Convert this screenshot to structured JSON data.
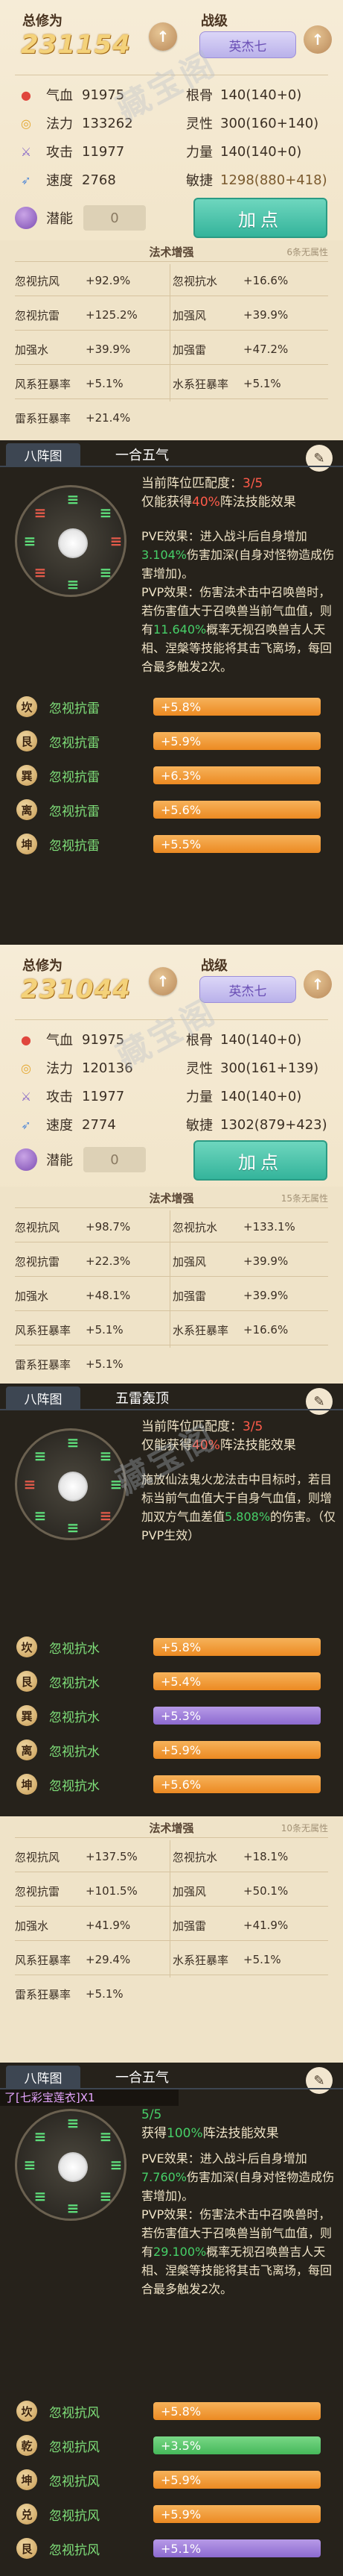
{
  "labels": {
    "total": "总修为",
    "zhanji": "战级",
    "potential": "潜能",
    "add_point": "加点",
    "fa_title": "法术增强",
    "formation_tab": "八阵图"
  },
  "stats_1": {
    "total_value": "231154",
    "zhanji_value": "英杰七",
    "qixue": {
      "k": "气血",
      "v": "91975"
    },
    "genggu": {
      "k": "根骨",
      "v": "140(140+0)"
    },
    "fali": {
      "k": "法力",
      "v": "133262"
    },
    "lingxing": {
      "k": "灵性",
      "v": "300(160+140)"
    },
    "gongji": {
      "k": "攻击",
      "v": "11977"
    },
    "liliang": {
      "k": "力量",
      "v": "140(140+0)"
    },
    "sudu": {
      "k": "速度",
      "v": "2768"
    },
    "minjie": {
      "k": "敏捷",
      "v": "1298(880+418)"
    },
    "potential_value": "0"
  },
  "fa_1": {
    "hint": "6条无属性",
    "rows": [
      [
        "忽视抗风",
        "+92.9%",
        "忽视抗水",
        "+16.6%"
      ],
      [
        "忽视抗雷",
        "+125.2%",
        "加强风",
        "+39.9%"
      ],
      [
        "加强水",
        "+39.9%",
        "加强雷",
        "+47.2%"
      ],
      [
        "风系狂暴率",
        "+5.1%",
        "水系狂暴率",
        "+5.1%"
      ],
      [
        "雷系狂暴率",
        "+21.4%",
        "",
        ""
      ]
    ]
  },
  "zf_1": {
    "name": "一合五气",
    "match_label": "当前阵位匹配度：",
    "match_value": "3/5",
    "gain_a": "仅能获得",
    "gain_pct": "40%",
    "gain_b": "阵法技能效果",
    "effect_pve_a": "PVE效果：进入战斗后自身增加",
    "effect_pve_pct": "3.104%",
    "effect_pve_b": "伤害加深(自身对怪物造成伤害增加)。",
    "effect_pvp_a": "PVP效果：伤害法术击中召唤兽时，若伤害值大于召唤兽当前气血值，则有",
    "effect_pvp_pct": "11.640%",
    "effect_pvp_b": "概率无视召唤兽吉人天相、涅槃等技能将其击飞离场，每回合最多触发2次。",
    "positions": [
      {
        "icon": "坎",
        "label": "忽视抗雷",
        "bar": "+5.8%"
      },
      {
        "icon": "艮",
        "label": "忽视抗雷",
        "bar": "+5.9%"
      },
      {
        "icon": "巽",
        "label": "忽视抗雷",
        "bar": "+6.3%"
      },
      {
        "icon": "离",
        "label": "忽视抗雷",
        "bar": "+5.6%"
      },
      {
        "icon": "坤",
        "label": "忽视抗雷",
        "bar": "+5.5%"
      }
    ]
  },
  "stats_2": {
    "total_value": "231044",
    "zhanji_value": "英杰七",
    "qixue": {
      "k": "气血",
      "v": "91975"
    },
    "genggu": {
      "k": "根骨",
      "v": "140(140+0)"
    },
    "fali": {
      "k": "法力",
      "v": "120136"
    },
    "lingxing": {
      "k": "灵性",
      "v": "300(161+139)"
    },
    "gongji": {
      "k": "攻击",
      "v": "11977"
    },
    "liliang": {
      "k": "力量",
      "v": "140(140+0)"
    },
    "sudu": {
      "k": "速度",
      "v": "2774"
    },
    "minjie": {
      "k": "敏捷",
      "v": "1302(879+423)"
    },
    "potential_value": "0"
  },
  "fa_2": {
    "hint": "15条无属性",
    "rows": [
      [
        "忽视抗风",
        "+98.7%",
        "忽视抗水",
        "+133.1%"
      ],
      [
        "忽视抗雷",
        "+22.3%",
        "加强风",
        "+39.9%"
      ],
      [
        "加强水",
        "+48.1%",
        "加强雷",
        "+39.9%"
      ],
      [
        "风系狂暴率",
        "+5.1%",
        "水系狂暴率",
        "+16.6%"
      ],
      [
        "雷系狂暴率",
        "+5.1%",
        "",
        ""
      ]
    ]
  },
  "zf_2": {
    "name": "五雷轰顶",
    "match_label": "当前阵位匹配度：",
    "match_value": "3/5",
    "gain_a": "仅能获得",
    "gain_pct": "40%",
    "gain_b": "阵法技能效果",
    "effect_a": "施放仙法鬼火龙法击中目标时，若目标当前气血值大于自身气血值，则增加双方气血差值",
    "effect_pct": "5.808%",
    "effect_b": "的伤害。（仅PVP生效）",
    "positions": [
      {
        "icon": "坎",
        "label": "忽视抗水",
        "bar": "+5.8%"
      },
      {
        "icon": "艮",
        "label": "忽视抗水",
        "bar": "+5.4%"
      },
      {
        "icon": "巽",
        "label": "忽视抗水",
        "bar": "+5.3%"
      },
      {
        "icon": "离",
        "label": "忽视抗水",
        "bar": "+5.9%"
      },
      {
        "icon": "坤",
        "label": "忽视抗水",
        "bar": "+5.6%"
      }
    ]
  },
  "fa_3": {
    "hint": "10条无属性",
    "rows": [
      [
        "忽视抗风",
        "+137.5%",
        "忽视抗水",
        "+18.1%"
      ],
      [
        "忽视抗雷",
        "+101.5%",
        "加强风",
        "+50.1%"
      ],
      [
        "加强水",
        "+41.9%",
        "加强雷",
        "+41.9%"
      ],
      [
        "风系狂暴率",
        "+29.4%",
        "水系狂暴率",
        "+5.1%"
      ],
      [
        "雷系狂暴率",
        "+5.1%",
        "",
        ""
      ]
    ]
  },
  "zf_3": {
    "name": "一合五气",
    "chat_overlay": "了[七彩宝莲衣]X1",
    "match_value": "5/5",
    "gain_a": "获得",
    "gain_pct": "100%",
    "gain_b": "阵法技能效果",
    "effect_pve_a": "PVE效果：进入战斗后自身增加",
    "effect_pve_pct": "7.760%",
    "effect_pve_b": "伤害加深(自身对怪物造成伤害增加)。",
    "effect_pvp_a": "PVP效果：伤害法术击中召唤兽时，若伤害值大于召唤兽当前气血值，则有",
    "effect_pvp_pct": "29.100%",
    "effect_pvp_b": "概率无视召唤兽吉人天相、涅槃等技能将其击飞离场，每回合最多触发2次。",
    "positions": [
      {
        "icon": "坎",
        "label": "忽视抗风",
        "bar": "+5.8%"
      },
      {
        "icon": "乾",
        "label": "忽视抗风",
        "bar": "+3.5%"
      },
      {
        "icon": "坤",
        "label": "忽视抗风",
        "bar": "+5.9%"
      },
      {
        "icon": "兑",
        "label": "忽视抗风",
        "bar": "+5.9%"
      },
      {
        "icon": "艮",
        "label": "忽视抗风",
        "bar": "+5.1%"
      }
    ]
  },
  "watermark": "藏宝阁"
}
